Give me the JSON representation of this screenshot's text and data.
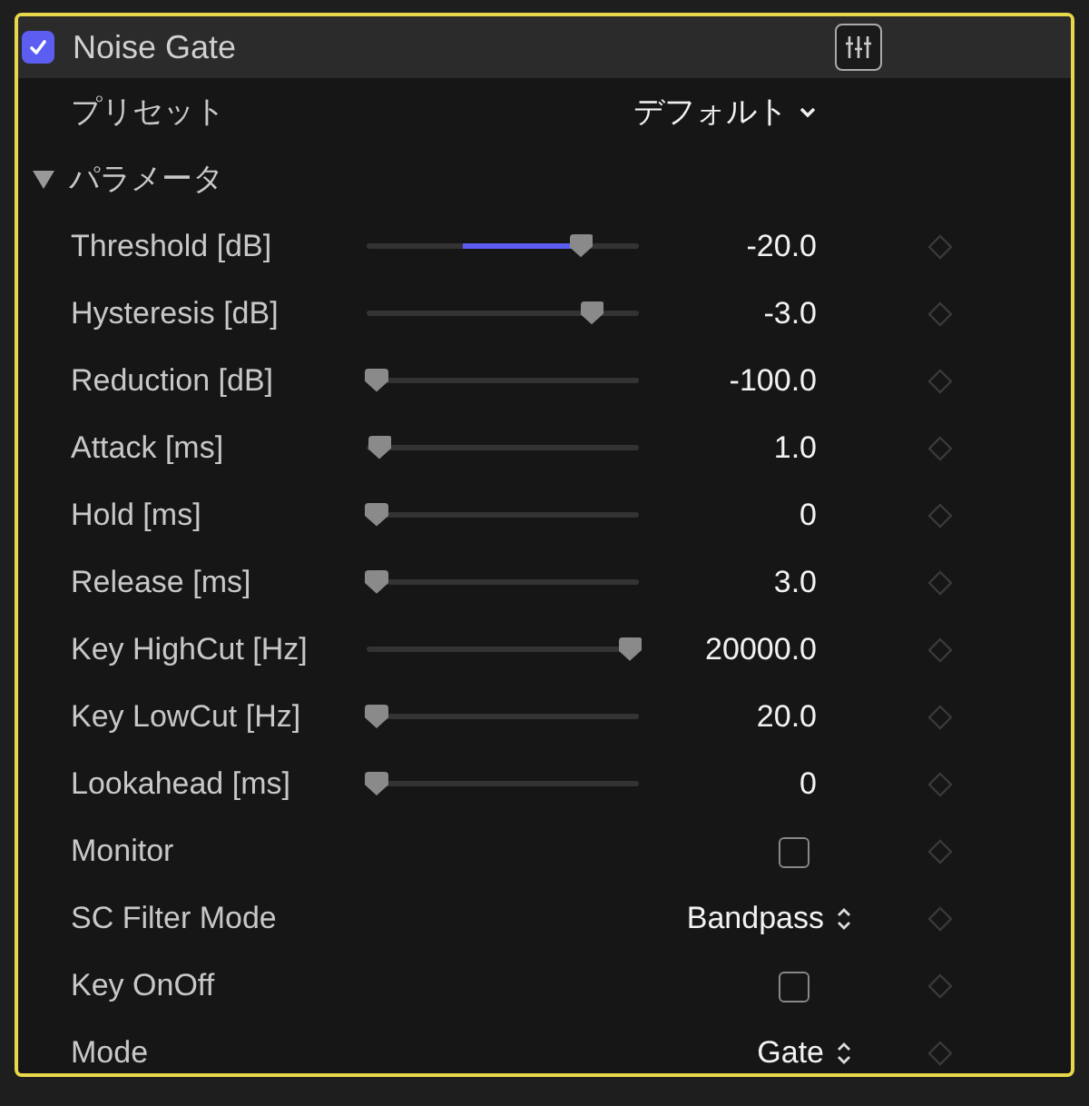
{
  "header": {
    "title": "Noise Gate",
    "enabled": true
  },
  "preset": {
    "label": "プリセット",
    "value": "デフォルト"
  },
  "group": {
    "label": "パラメータ",
    "expanded": true
  },
  "parameters": [
    {
      "kind": "slider",
      "label": "Threshold [dB]",
      "level": 0.79,
      "active": true,
      "value": "-20.0"
    },
    {
      "kind": "slider",
      "label": "Hysteresis [dB]",
      "level": 0.83,
      "active": false,
      "value": "-3.0"
    },
    {
      "kind": "slider",
      "label": "Reduction [dB]",
      "level": 0.04,
      "active": false,
      "value": "-100.0"
    },
    {
      "kind": "slider",
      "label": "Attack [ms]",
      "level": 0.05,
      "active": false,
      "value": "1.0"
    },
    {
      "kind": "slider",
      "label": "Hold [ms]",
      "level": 0.04,
      "active": false,
      "value": "0"
    },
    {
      "kind": "slider",
      "label": "Release [ms]",
      "level": 0.04,
      "active": false,
      "value": "3.0"
    },
    {
      "kind": "slider",
      "label": "Key HighCut [Hz]",
      "level": 0.97,
      "active": false,
      "value": "20000.0"
    },
    {
      "kind": "slider",
      "label": "Key LowCut [Hz]",
      "level": 0.04,
      "active": false,
      "value": "20.0"
    },
    {
      "kind": "slider",
      "label": "Lookahead [ms]",
      "level": 0.04,
      "active": false,
      "value": "0"
    },
    {
      "kind": "checkbox",
      "label": "Monitor",
      "checked": false
    },
    {
      "kind": "popup",
      "label": "SC Filter Mode",
      "value": "Bandpass"
    },
    {
      "kind": "checkbox",
      "label": "Key OnOff",
      "checked": false
    },
    {
      "kind": "popup",
      "label": "Mode",
      "value": "Gate"
    }
  ]
}
